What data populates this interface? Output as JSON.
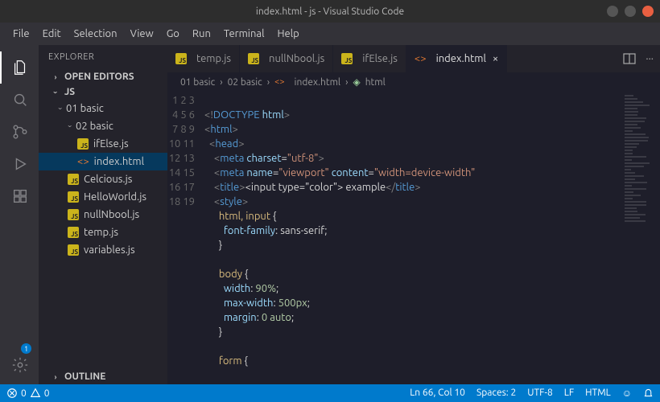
{
  "title": "index.html - js - Visual Studio Code",
  "menu": [
    "File",
    "Edit",
    "Selection",
    "View",
    "Go",
    "Run",
    "Terminal",
    "Help"
  ],
  "activity_badge": "1",
  "explorer": {
    "title": "EXPLORER",
    "sections": {
      "open_editors": "OPEN EDITORS",
      "workspace": "JS",
      "outline": "OUTLINE"
    },
    "tree": {
      "folder1": "01 basic",
      "folder2": "02 basic",
      "f_ifelse": "ifElse.js",
      "f_index": "index.html",
      "f_celcious": "Celcious.js",
      "f_hello": "HelloWorld.js",
      "f_nullnbool": "nullNbool.js",
      "f_temp": "temp.js",
      "f_variables": "variables.js"
    }
  },
  "tabs": [
    {
      "label": "temp.js",
      "icon": "js",
      "active": false
    },
    {
      "label": "nullNbool.js",
      "icon": "js",
      "active": false
    },
    {
      "label": "ifElse.js",
      "icon": "js",
      "active": false
    },
    {
      "label": "index.html",
      "icon": "html",
      "active": true
    }
  ],
  "breadcrumb": [
    "01 basic",
    "02 basic",
    "index.html",
    "html"
  ],
  "code_lines_start": 1,
  "code_lines_end": 19,
  "code": {
    "l2": "<!DOCTYPE html>",
    "l3_open": "<html>",
    "l4": "<head>",
    "l5_tag": "meta",
    "l5_a1": "charset",
    "l5_v1": "\"utf-8\"",
    "l6_tag": "meta",
    "l6_a1": "name",
    "l6_v1": "\"viewport\"",
    "l6_a2": "content",
    "l6_v2": "\"width=device-width\"",
    "l7_tago": "title",
    "l7_txt": "&lt;input type=\"color\"&gt; example",
    "l7_tagc": "title",
    "l8": "style",
    "l9_sel": "html, input",
    "l9_b": "{",
    "l10_p": "font-family",
    "l10_v": "sans-serif",
    "l11": "}",
    "l13_sel": "body",
    "l13_b": "{",
    "l14_p": "width",
    "l14_v": "90%",
    "l15_p": "max-width",
    "l15_v": "500px",
    "l16_p": "margin",
    "l16_v": "0 auto",
    "l17": "}",
    "l19_sel": "form",
    "l19_b": "{"
  },
  "status": {
    "errors": "0",
    "warnings": "0",
    "ln_col": "Ln 66, Col 10",
    "spaces": "Spaces: 2",
    "encoding": "UTF-8",
    "eol": "LF",
    "lang": "HTML"
  }
}
